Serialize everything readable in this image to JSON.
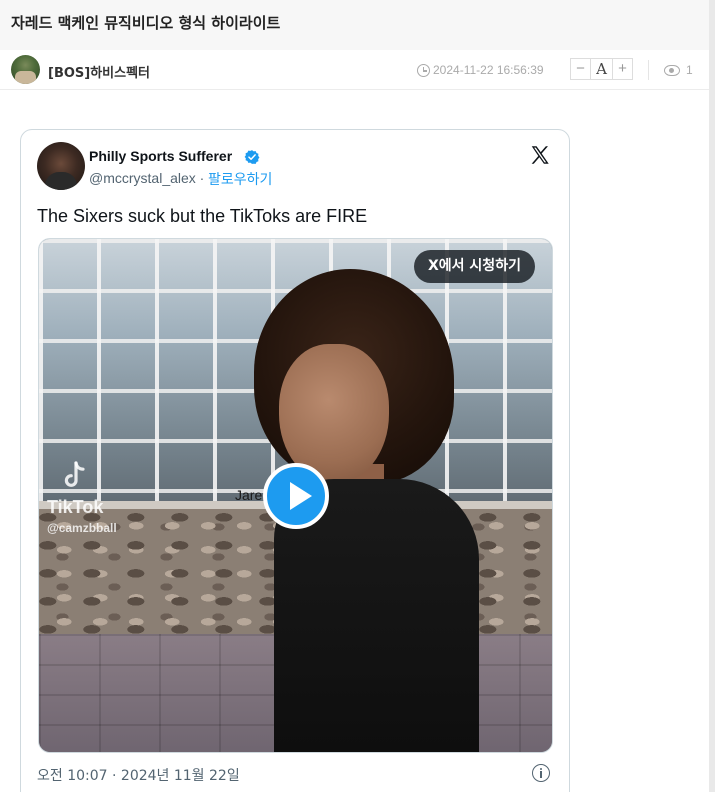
{
  "post": {
    "title": "자레드 맥케인 뮤직비디오 형식 하이라이트",
    "author": "[BOS]하비스펙터",
    "date": "2024-11-22 16:56:39",
    "font_minus": "−",
    "font_a": "A",
    "font_plus": "+",
    "views": "1"
  },
  "tweet": {
    "display_name": "Philly Sports Sufferer",
    "handle": "@mccrystal_alex",
    "separator": " · ",
    "follow": "팔로우하기",
    "text": "The Sixers suck but the TikToks are FIRE",
    "watch_on_x": "X에서 시청하기",
    "timestamp": "오전 10:07 · 2024년 11월 22일",
    "media": {
      "watermark_brand": "TikTok",
      "watermark_user": "@camzbball",
      "caption_overlay": "Jare      n"
    }
  },
  "colors": {
    "link": "#1d9bf0",
    "verified": "#1d9bf0",
    "muted": "#536471",
    "header_bg": "#f7f7f7"
  },
  "icons": {
    "clock": "clock-icon",
    "eye": "eye-icon",
    "verified": "verified-badge-icon",
    "x_logo": "x-logo-icon",
    "play": "play-icon",
    "info": "info-icon"
  }
}
